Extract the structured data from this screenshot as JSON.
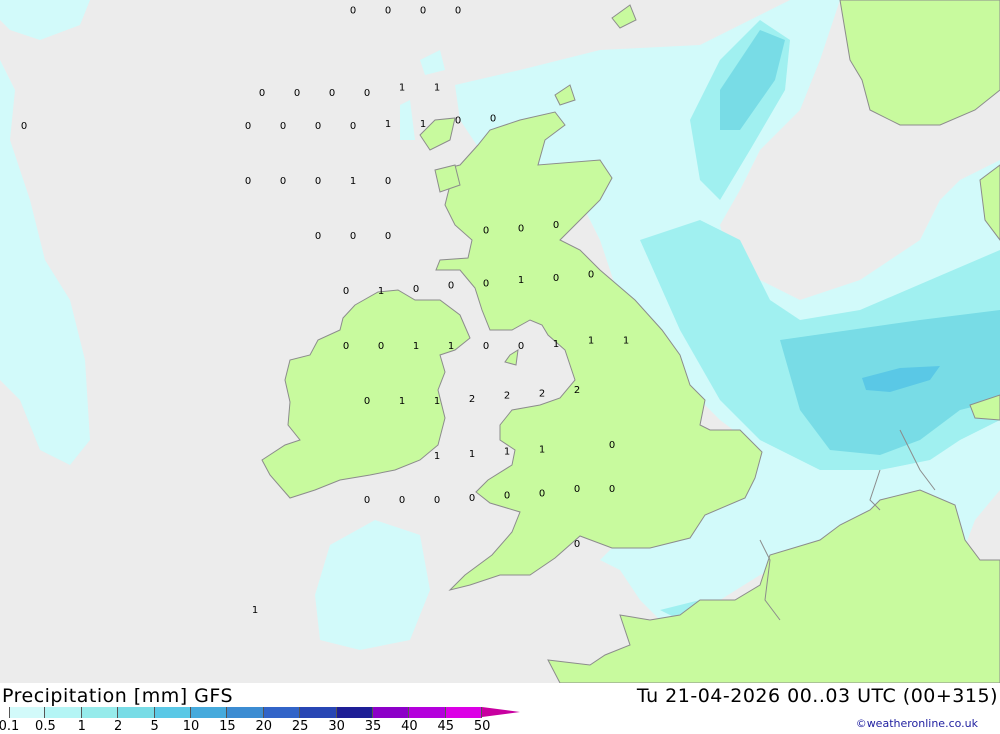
{
  "title": "Precipitation [mm] GFS",
  "run_info": "Tu 21-04-2026 00..03 UTC (00+315)",
  "credit": "©weatheronline.co.uk",
  "colors": {
    "sea": "#ececec",
    "land": "#c8fa9e",
    "coast": "#8c8c8c",
    "precip_light": "#d2fafa",
    "precip_mid": "#a0f0f0",
    "precip_heavy": "#5ad2e6"
  },
  "legend": {
    "labels": [
      "0.1",
      "0.5",
      "1",
      "2",
      "5",
      "10",
      "15",
      "20",
      "25",
      "30",
      "35",
      "40",
      "45",
      "50"
    ],
    "colors": [
      "#d2fafa",
      "#b4f5f5",
      "#96ebeb",
      "#78dce6",
      "#5ac8e6",
      "#46aadc",
      "#3c8cd2",
      "#3264c8",
      "#2846b4",
      "#1e1e96",
      "#8c00c8",
      "#b400dc",
      "#dc00e6",
      "#c800a0"
    ]
  },
  "points": [
    {
      "v": "0",
      "lon": -14.8,
      "lat": 61.95
    },
    {
      "v": "0",
      "lon": -14.3,
      "lat": 61.9
    },
    {
      "v": "0",
      "lon": -15.1,
      "lat": 61.25
    },
    {
      "v": "0",
      "lon": -7.8,
      "lat": 61.3
    },
    {
      "v": "0",
      "lon": -15.3,
      "lat": 60.0
    },
    {
      "v": "0",
      "lon": -14.8,
      "lat": 59.98
    },
    {
      "v": "0",
      "lon": -14.9,
      "lat": 59.5
    },
    {
      "v": "0",
      "lon": -14.4,
      "lat": 59.48
    },
    {
      "v": "0",
      "lon": -14.6,
      "lat": 59.05
    },
    {
      "v": "0",
      "lon": -14.9,
      "lat": 58.6
    },
    {
      "v": "0",
      "lon": -14.3,
      "lat": 58.55
    },
    {
      "v": "0",
      "lon": -7.3,
      "lat": 60.9
    },
    {
      "v": "0",
      "lon": -6.8,
      "lat": 60.9
    },
    {
      "v": "0",
      "lon": -3.4,
      "lat": 61.2
    },
    {
      "v": "0",
      "lon": -2.9,
      "lat": 61.2
    },
    {
      "v": "0",
      "lon": -2.4,
      "lat": 61.2
    },
    {
      "v": "0",
      "lon": -1.9,
      "lat": 61.2
    },
    {
      "v": "1",
      "lon": -1.4,
      "lat": 61.25
    },
    {
      "v": "1",
      "lon": -0.9,
      "lat": 61.25
    },
    {
      "v": "0",
      "lon": -3.6,
      "lat": 60.9
    },
    {
      "v": "0",
      "lon": -3.1,
      "lat": 60.9
    },
    {
      "v": "0",
      "lon": -2.6,
      "lat": 60.9
    },
    {
      "v": "0",
      "lon": -2.1,
      "lat": 60.9
    },
    {
      "v": "1",
      "lon": -1.6,
      "lat": 60.92
    },
    {
      "v": "1",
      "lon": -1.1,
      "lat": 60.92
    },
    {
      "v": "0",
      "lon": -0.6,
      "lat": 60.95
    },
    {
      "v": "0",
      "lon": -0.1,
      "lat": 60.97
    },
    {
      "v": "0",
      "lon": -2.1,
      "lat": 61.95
    },
    {
      "v": "0",
      "lon": -1.6,
      "lat": 61.95
    },
    {
      "v": "0",
      "lon": -1.1,
      "lat": 61.95
    },
    {
      "v": "0",
      "lon": -0.6,
      "lat": 61.95
    },
    {
      "v": "0",
      "lon": -3.6,
      "lat": 60.4
    },
    {
      "v": "0",
      "lon": -3.1,
      "lat": 60.4
    },
    {
      "v": "0",
      "lon": -2.6,
      "lat": 60.4
    },
    {
      "v": "1",
      "lon": -2.1,
      "lat": 60.4
    },
    {
      "v": "0",
      "lon": -1.6,
      "lat": 60.4
    },
    {
      "v": "0",
      "lon": -2.6,
      "lat": 59.9
    },
    {
      "v": "0",
      "lon": -2.1,
      "lat": 59.9
    },
    {
      "v": "0",
      "lon": -1.6,
      "lat": 59.9
    },
    {
      "v": "0",
      "lon": -2.2,
      "lat": 59.4
    },
    {
      "v": "1",
      "lon": -1.7,
      "lat": 59.4
    },
    {
      "v": "0",
      "lon": -1.2,
      "lat": 59.42
    },
    {
      "v": "0",
      "lon": -2.2,
      "lat": 58.9
    },
    {
      "v": "0",
      "lon": -1.7,
      "lat": 58.9
    },
    {
      "v": "1",
      "lon": -1.2,
      "lat": 58.9
    },
    {
      "v": "1",
      "lon": -0.7,
      "lat": 58.9
    },
    {
      "v": "0",
      "lon": -0.2,
      "lat": 58.9
    },
    {
      "v": "0",
      "lon": 0.3,
      "lat": 58.9
    },
    {
      "v": "1",
      "lon": 0.8,
      "lat": 58.92
    },
    {
      "v": "1",
      "lon": 1.3,
      "lat": 58.95
    },
    {
      "v": "1",
      "lon": 1.8,
      "lat": 58.95
    },
    {
      "v": "0",
      "lon": -1.9,
      "lat": 58.4
    },
    {
      "v": "1",
      "lon": -1.4,
      "lat": 58.4
    },
    {
      "v": "1",
      "lon": -0.9,
      "lat": 58.4
    },
    {
      "v": "2",
      "lon": -0.4,
      "lat": 58.42
    },
    {
      "v": "2",
      "lon": 0.1,
      "lat": 58.45
    },
    {
      "v": "2",
      "lon": 0.6,
      "lat": 58.47
    },
    {
      "v": "2",
      "lon": 1.1,
      "lat": 58.5
    },
    {
      "v": "1",
      "lon": -0.9,
      "lat": 57.9
    },
    {
      "v": "1",
      "lon": -0.4,
      "lat": 57.92
    },
    {
      "v": "1",
      "lon": 0.1,
      "lat": 57.94
    },
    {
      "v": "1",
      "lon": 0.6,
      "lat": 57.96
    },
    {
      "v": "0",
      "lon": 1.6,
      "lat": 58.0
    },
    {
      "v": "0",
      "lon": -0.2,
      "lat": 59.95
    },
    {
      "v": "0",
      "lon": 0.3,
      "lat": 59.97
    },
    {
      "v": "0",
      "lon": 0.8,
      "lat": 60.0
    },
    {
      "v": "0",
      "lon": -0.7,
      "lat": 59.45
    },
    {
      "v": "0",
      "lon": -0.2,
      "lat": 59.47
    },
    {
      "v": "1",
      "lon": 0.3,
      "lat": 59.5
    },
    {
      "v": "0",
      "lon": 0.8,
      "lat": 59.52
    },
    {
      "v": "0",
      "lon": 1.3,
      "lat": 59.55
    },
    {
      "v": "0",
      "lon": -1.9,
      "lat": 57.5
    },
    {
      "v": "0",
      "lon": -1.4,
      "lat": 57.5
    },
    {
      "v": "0",
      "lon": -0.9,
      "lat": 57.5
    },
    {
      "v": "0",
      "lon": -0.4,
      "lat": 57.52
    },
    {
      "v": "0",
      "lon": 0.1,
      "lat": 57.54
    },
    {
      "v": "0",
      "lon": 0.6,
      "lat": 57.56
    },
    {
      "v": "0",
      "lon": 1.1,
      "lat": 57.6
    },
    {
      "v": "0",
      "lon": 1.6,
      "lat": 57.6
    },
    {
      "v": "0",
      "lon": 1.1,
      "lat": 57.1
    },
    {
      "v": "0",
      "lon": -10.4,
      "lat": 57.1
    },
    {
      "v": "0",
      "lon": -9.9,
      "lat": 57.1
    },
    {
      "v": "0",
      "lon": -10.4,
      "lat": 56.6
    },
    {
      "v": "0",
      "lon": -9.9,
      "lat": 56.6
    },
    {
      "v": "1",
      "lon": -3.5,
      "lat": 56.5
    }
  ]
}
